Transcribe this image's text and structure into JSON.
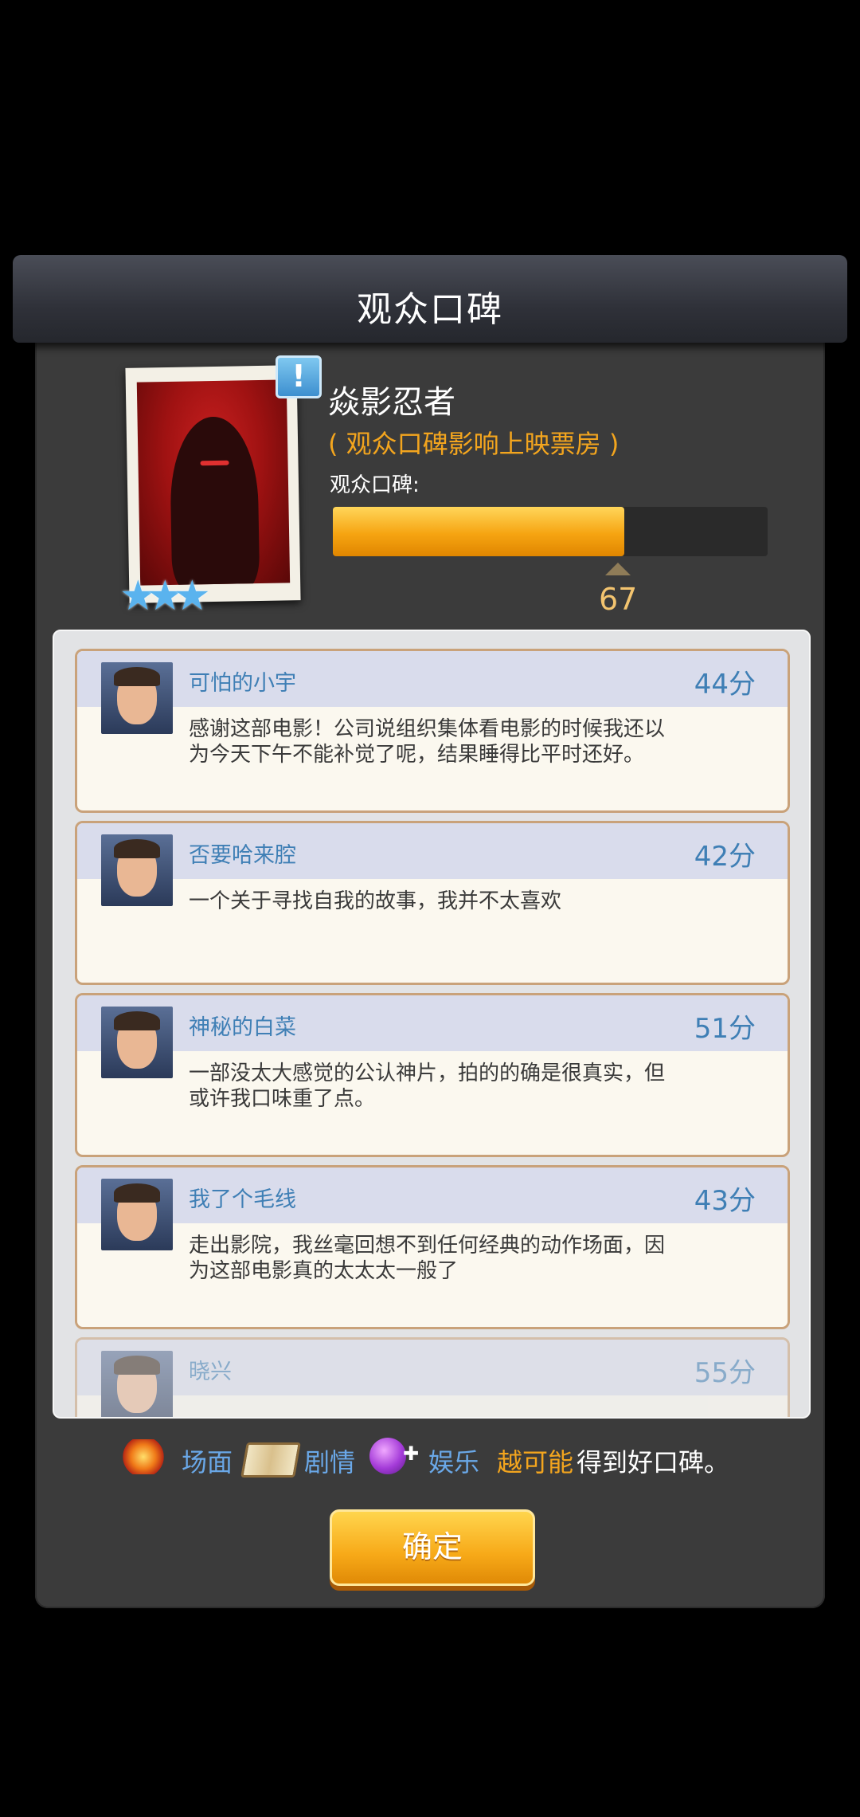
{
  "dialog": {
    "title": "观众口碑"
  },
  "movie": {
    "title": "焱影忍者",
    "note": "( 观众口碑影响上映票房 )",
    "rating_label": "观众口碑:",
    "rating_value": "67",
    "rating_fraction": 0.67,
    "stars": 3,
    "alert_badge": "!"
  },
  "reviews": [
    {
      "name": "可怕的小宇",
      "score": "44分",
      "text": "感谢这部电影！公司说组织集体看电影的时候我还以为今天下午不能补觉了呢，结果睡得比平时还好。"
    },
    {
      "name": "否要哈来腔",
      "score": "42分",
      "text": "一个关于寻找自我的故事，我并不太喜欢"
    },
    {
      "name": "神秘的白菜",
      "score": "51分",
      "text": "一部没太大感觉的公认神片，拍的的确是很真实，但或许我口味重了点。"
    },
    {
      "name": "我了个毛线",
      "score": "43分",
      "text": "走出影院，我丝毫回想不到任何经典的动作场面，因为这部电影真的太太太一般了"
    },
    {
      "name": "晓兴",
      "score": "55分",
      "text": ""
    }
  ],
  "hint": {
    "spectacle": "场面",
    "story": "剧情",
    "entertainment": "娱乐",
    "more_likely": "越可能",
    "rest": "得到好口碑。"
  },
  "buttons": {
    "confirm": "确定"
  },
  "colors": {
    "accent_orange": "#f3a51e",
    "link_blue": "#3f7fb5",
    "star_blue": "#5ab3ee"
  }
}
